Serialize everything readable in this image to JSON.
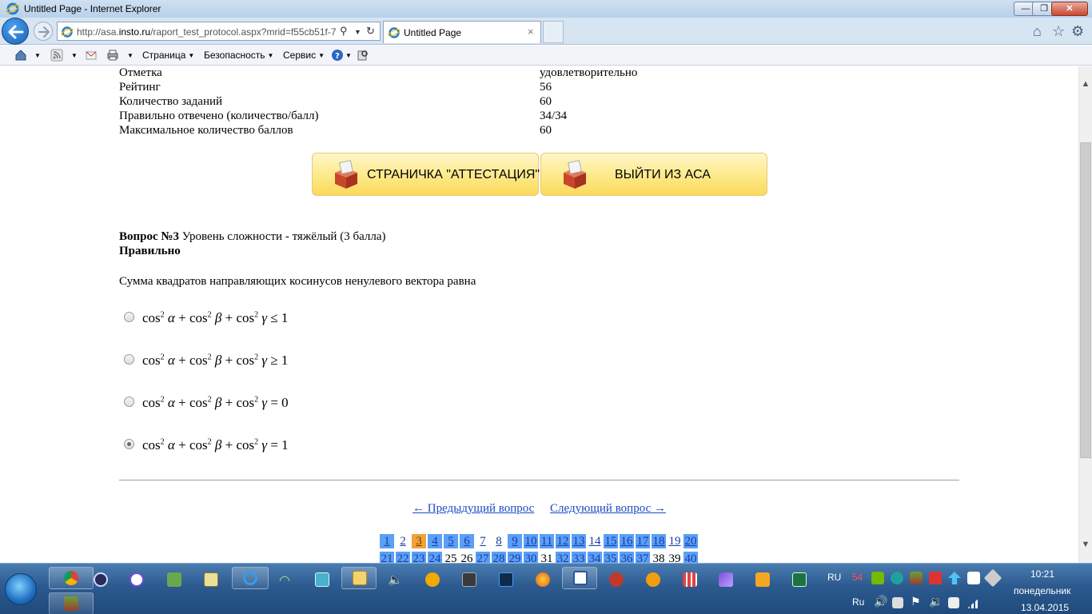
{
  "window": {
    "title": "Untitled Page - Internet Explorer",
    "min": "—",
    "max": "❐",
    "close": "✕"
  },
  "navbar": {
    "url_prefix": "http://asa.",
    "url_host": "insto.ru",
    "url_rest": "/raport_test_protocol.aspx?mrid=f55cb51f-7",
    "tab_title": "Untitled Page",
    "tab_close": "×"
  },
  "cmdbar": {
    "page": "Страница",
    "security": "Безопасность",
    "service": "Сервис"
  },
  "stats": [
    {
      "label": "Отметка",
      "value": "удовлетворительно"
    },
    {
      "label": "Рейтинг",
      "value": "56"
    },
    {
      "label": "Количество заданий",
      "value": "60"
    },
    {
      "label": "Правильно отвечено (количество/балл)",
      "value": "34/34"
    },
    {
      "label": "Максимальное количество баллов",
      "value": "60"
    }
  ],
  "buttons": {
    "attestation": "СТРАНИЧКА \"АТТЕСТАЦИЯ\"",
    "exit": "ВЫЙТИ ИЗ АСА"
  },
  "question": {
    "number_label": "Вопрос №3",
    "level": " Уровень сложности - тяжёлый (3 балла)",
    "status": "Правильно",
    "text": "Сумма квадратов направляющих косинусов ненулевого вектора равна",
    "options": [
      {
        "relation": "≤ 1",
        "checked": false
      },
      {
        "relation": "≥ 1",
        "checked": false
      },
      {
        "relation": "= 0",
        "checked": false
      },
      {
        "relation": "= 1",
        "checked": true
      }
    ],
    "formula_parts": {
      "cos": "cos",
      "sq": "2",
      "alpha": "α",
      "beta": "β",
      "gamma": "γ",
      "plus": "+"
    }
  },
  "nav": {
    "prev": "← Предыдущий вопрос",
    "next": "Следующий вопрос →"
  },
  "pager": {
    "row1": [
      "1",
      "2",
      "3",
      "4",
      "5",
      "6",
      "7",
      "8",
      "9",
      "10",
      "11",
      "12",
      "13",
      "14",
      "15",
      "16",
      "17",
      "18",
      "19",
      "20"
    ],
    "row2": [
      "21",
      "22",
      "23",
      "24",
      "25",
      "26",
      "27",
      "28",
      "29",
      "30",
      "31",
      "32",
      "33",
      "34",
      "35",
      "36",
      "37",
      "38",
      "39",
      "40"
    ],
    "current": "3",
    "highlighted": [
      "1",
      "4",
      "5",
      "6",
      "9",
      "10",
      "11",
      "12",
      "13",
      "15",
      "16",
      "17",
      "18",
      "20",
      "21",
      "22",
      "23",
      "24",
      "27",
      "28",
      "29",
      "30",
      "32",
      "33",
      "34",
      "35",
      "36",
      "37",
      "40"
    ],
    "plain": [
      "25",
      "26",
      "31",
      "38",
      "39"
    ]
  },
  "taskbar": {
    "lang": "RU",
    "lang2": "Ru",
    "temp": "54",
    "time": "10:21",
    "day": "понедельник",
    "date": "13.04.2015"
  },
  "colors": {
    "link": "#1a4ac7",
    "page_highlight": "#5aa0f6",
    "page_current": "#f0a338",
    "button_yellow": "#fde989"
  }
}
